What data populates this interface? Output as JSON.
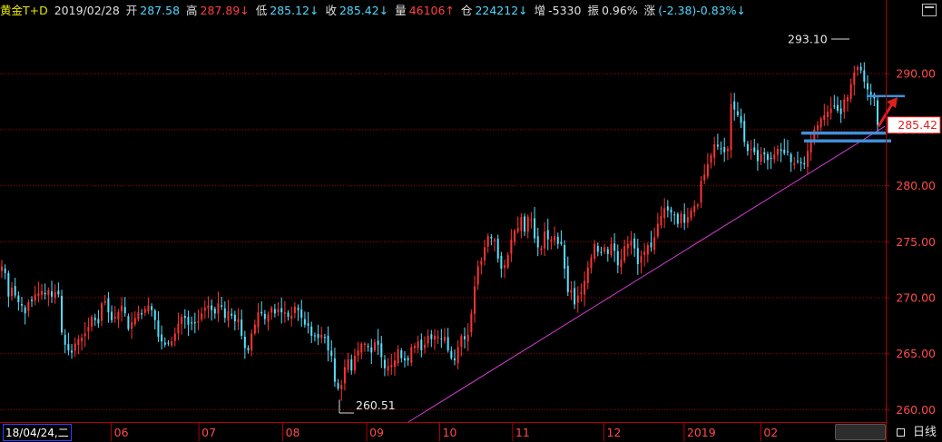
{
  "header": {
    "symbol": "黄金T+D",
    "date": "2019/02/28",
    "open_label": "开",
    "open_value": "287.58",
    "high_label": "高",
    "high_value": "287.89↓",
    "low_label": "低",
    "low_value": "285.12↓",
    "close_label": "收",
    "close_value": "285.42↓",
    "volume_label": "量",
    "volume_value": "46106↑",
    "oi_label": "仓",
    "oi_value": "224212↓",
    "change_oi_label": "增",
    "change_oi_value": "-5330",
    "amplitude_label": "振",
    "amplitude_value": "0.96%",
    "change_label": "涨",
    "change_value": "(-2.38)-0.83%↓"
  },
  "footer": {
    "current_date": "18/04/24,二",
    "period": "日线"
  },
  "colors": {
    "up": "#ff3333",
    "down": "#55e0ff",
    "trendline": "#d83cd8",
    "support_lines": "#3f8fd8",
    "arrow": "#e02020",
    "grid": "#b00000"
  },
  "chart_data": {
    "type": "candlestick",
    "title": "",
    "ylim": [
      258.9,
      294.8
    ],
    "y_ticks": [
      "290.00",
      "285.00",
      "280.00",
      "275.00",
      "270.00",
      "265.00",
      "260.00"
    ],
    "x_ticks": [
      "06",
      "07",
      "08",
      "09",
      "10",
      "11",
      "12",
      "2019",
      "02"
    ],
    "grid": "horizontal dotted",
    "annotations": {
      "high_mark": "293.10",
      "low_mark": "260.51",
      "last_price": "285.42"
    },
    "closes": [
      272.8,
      272.2,
      270.1,
      270.9,
      270.2,
      269.6,
      269.3,
      268.6,
      269.6,
      269.7,
      270.3,
      270.4,
      270.6,
      270.3,
      270.7,
      270.1,
      270.5,
      270.3,
      266.9,
      265.8,
      265.3,
      265.1,
      265.9,
      266.3,
      266.4,
      266.8,
      267.4,
      268.3,
      268.0,
      267.7,
      269.5,
      269.7,
      268.7,
      268.0,
      268.3,
      268.7,
      269.3,
      268.6,
      267.2,
      267.8,
      268.2,
      268.7,
      268.5,
      269.0,
      269.3,
      268.9,
      268.0,
      266.5,
      266.1,
      265.8,
      265.9,
      266.1,
      266.8,
      267.7,
      268.3,
      268.2,
      267.6,
      267.7,
      267.8,
      267.9,
      268.6,
      269.1,
      269.3,
      268.9,
      268.6,
      269.5,
      269.2,
      268.2,
      268.8,
      268.4,
      267.9,
      268.1,
      266.6,
      265.5,
      265.3,
      266.8,
      267.6,
      268.7,
      268.6,
      268.1,
      268.5,
      269.1,
      268.6,
      269.0,
      268.7,
      268.7,
      268.3,
      268.4,
      269.2,
      268.9,
      268.2,
      267.6,
      267.5,
      266.6,
      266.6,
      266.4,
      266.7,
      266.4,
      265.3,
      264.8,
      262.5,
      261.9,
      262.2,
      263.8,
      264.5,
      263.5,
      264.8,
      265.3,
      265.9,
      265.9,
      265.6,
      265.1,
      266.0,
      265.8,
      264.7,
      263.7,
      263.9,
      264.0,
      264.4,
      265.4,
      264.6,
      264.4,
      264.4,
      265.6,
      265.7,
      266.1,
      265.3,
      265.8,
      266.6,
      266.3,
      266.6,
      266.5,
      266.3,
      266.5,
      265.3,
      264.6,
      264.4,
      265.6,
      266.6,
      266.3,
      266.7,
      268.6,
      271.0,
      272.8,
      273.3,
      274.5,
      275.5,
      275.3,
      275.2,
      273.5,
      272.6,
      272.9,
      273.8,
      275.2,
      276.0,
      276.2,
      277.2,
      275.9,
      277.2,
      277.0,
      275.3,
      274.5,
      274.4,
      275.9,
      275.2,
      275.2,
      275.5,
      274.8,
      274.8,
      272.6,
      270.5,
      270.7,
      269.4,
      270.2,
      270.5,
      271.5,
      272.7,
      273.6,
      274.8,
      274.1,
      274.0,
      274.5,
      273.9,
      274.8,
      274.2,
      272.9,
      273.4,
      274.6,
      274.8,
      275.1,
      274.4,
      273.0,
      273.7,
      274.1,
      274.7,
      274.5,
      275.4,
      276.6,
      277.3,
      278.0,
      277.8,
      277.6,
      277.4,
      276.6,
      277.5,
      276.7,
      277.2,
      277.8,
      278.2,
      278.3,
      280.4,
      281.0,
      281.9,
      282.7,
      283.7,
      283.5,
      283.3,
      283.0,
      283.3,
      287.3,
      286.8,
      286.3,
      285.6,
      283.9,
      283.1,
      283.3,
      283.0,
      282.2,
      282.8,
      282.8,
      282.3,
      282.4,
      282.8,
      283.3,
      283.1,
      282.9,
      283.0,
      282.1,
      282.0,
      282.2,
      282.0,
      281.9,
      283.1,
      284.0,
      285.0,
      285.4,
      286.0,
      286.3,
      286.6,
      286.9,
      287.1,
      286.7,
      286.4,
      287.7,
      287.9,
      289.1,
      290.1,
      290.6,
      290.3,
      289.3,
      288.6,
      288.1,
      287.8,
      285.4
    ]
  }
}
